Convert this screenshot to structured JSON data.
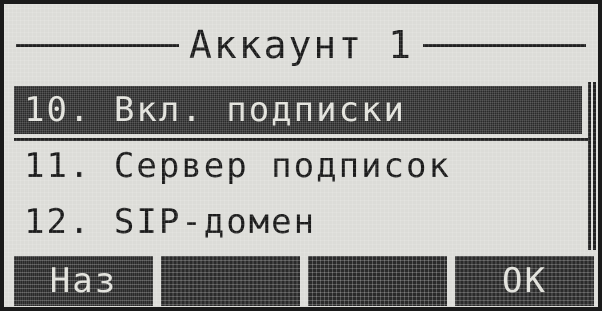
{
  "header": {
    "title": "Аккаунт 1"
  },
  "menu": {
    "items": [
      {
        "label": "10. Вкл. подписки",
        "selected": true
      },
      {
        "label": "11. Сервер подписок",
        "selected": false
      },
      {
        "label": "12. SIP-домен",
        "selected": false
      }
    ]
  },
  "softkeys": [
    {
      "label": "Наз"
    },
    {
      "label": ""
    },
    {
      "label": ""
    },
    {
      "label": "OK"
    }
  ]
}
